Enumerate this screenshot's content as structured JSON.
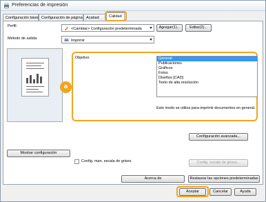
{
  "window": {
    "title": "Preferencias de impresión"
  },
  "tabs": [
    {
      "label": "Configuración básica"
    },
    {
      "label": "Configuración de página"
    },
    {
      "label": "Acabad"
    },
    {
      "label": "Calidad"
    }
  ],
  "profile": {
    "label": "Perfil:",
    "value": "<Cambiar> Configuración predeterminada",
    "add_label": "Agregar(1)...",
    "edit_label": "Editar(2)..."
  },
  "output": {
    "label": "Método de salida:",
    "value": "Imprimir"
  },
  "objective": {
    "label": "Objetivo:",
    "options": [
      "General",
      "Publicaciones",
      "Gráficos",
      "Fotos",
      "Diseños [CAD]",
      "Texto de alta resolución"
    ],
    "selected": "General",
    "description": "Este modo se utiliza para imprimir documentos en general."
  },
  "badge": "a",
  "buttons": {
    "advanced": "Configuración avanzada...",
    "show_config": "Mostrar configuración",
    "gray_scale": "Config. escala de grises...",
    "about": "Acerca de",
    "restore": "Restaurar las opciones predeterminadas",
    "accept": "Aceptar",
    "cancel": "Cancelar",
    "help": "Ayuda"
  },
  "grayscale_checkbox": {
    "label": "Config. man. escala de grises",
    "checked": false
  },
  "colors": {
    "highlight": "#f2a31f",
    "selection": "#3399ff"
  }
}
